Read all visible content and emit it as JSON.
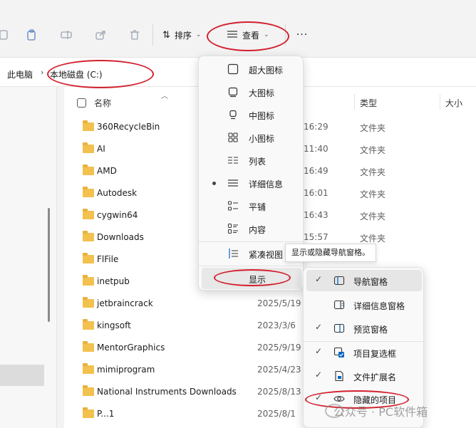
{
  "toolbar": {
    "sort_label": "排序",
    "view_label": "查看",
    "more_label": "···"
  },
  "breadcrumb": [
    "此电脑",
    "本地磁盘 (C:)"
  ],
  "columns": {
    "name": "名称",
    "type": "类型",
    "size": "大小"
  },
  "files": [
    {
      "name": "360RecycleBin",
      "date": "16:29",
      "type": "文件夹"
    },
    {
      "name": "AI",
      "date": "11:40",
      "type": "文件夹"
    },
    {
      "name": "AMD",
      "date": "16:49",
      "type": "文件夹"
    },
    {
      "name": "Autodesk",
      "date": "16:01",
      "type": "文件夹"
    },
    {
      "name": "cygwin64",
      "date": "16:43",
      "type": "文件夹"
    },
    {
      "name": "Downloads",
      "date": "15:57",
      "type": "文件夹"
    },
    {
      "name": "FlFile",
      "date": "",
      "type": ""
    },
    {
      "name": "inetpub",
      "date": "",
      "type": ""
    },
    {
      "name": "jetbraincrack",
      "date": "2025/5/19",
      "type": ""
    },
    {
      "name": "kingsoft",
      "date": "2023/3/6",
      "type": ""
    },
    {
      "name": "MentorGraphics",
      "date": "2025/9/19",
      "type": ""
    },
    {
      "name": "mimiprogram",
      "date": "2025/4/23",
      "type": ""
    },
    {
      "name": "National Instruments Downloads",
      "date": "2025/8/13",
      "type": ""
    },
    {
      "name": "P...1",
      "date": "2025/8/1",
      "type": ""
    }
  ],
  "view_menu": {
    "items": [
      {
        "label": "超大图标",
        "icon": "extra-large-icons-icon"
      },
      {
        "label": "大图标",
        "icon": "large-icons-icon"
      },
      {
        "label": "中图标",
        "icon": "medium-icons-icon"
      },
      {
        "label": "小图标",
        "icon": "small-icons-icon"
      },
      {
        "label": "列表",
        "icon": "list-icon"
      },
      {
        "label": "详细信息",
        "icon": "details-icon",
        "selected": true
      },
      {
        "label": "平铺",
        "icon": "tiles-icon"
      },
      {
        "label": "内容",
        "icon": "content-icon"
      },
      {
        "label": "紧凑视图",
        "icon": "compact-view-icon"
      },
      {
        "label": "显示",
        "icon": ""
      }
    ]
  },
  "tooltip": "显示或隐藏导航窗格。",
  "show_submenu": {
    "items": [
      {
        "label": "导航窗格",
        "checked": true
      },
      {
        "label": "详细信息窗格",
        "checked": false
      },
      {
        "label": "预览窗格",
        "checked": true
      },
      {
        "label": "项目复选框",
        "checked": true
      },
      {
        "label": "文件扩展名",
        "checked": true
      },
      {
        "label": "隐藏的项目",
        "checked": true
      }
    ]
  },
  "watermark": "公众号 · PC软件箱",
  "colors": {
    "annotation": "#d2202d",
    "folder": "#f2c14e",
    "accent": "#0067c0"
  }
}
